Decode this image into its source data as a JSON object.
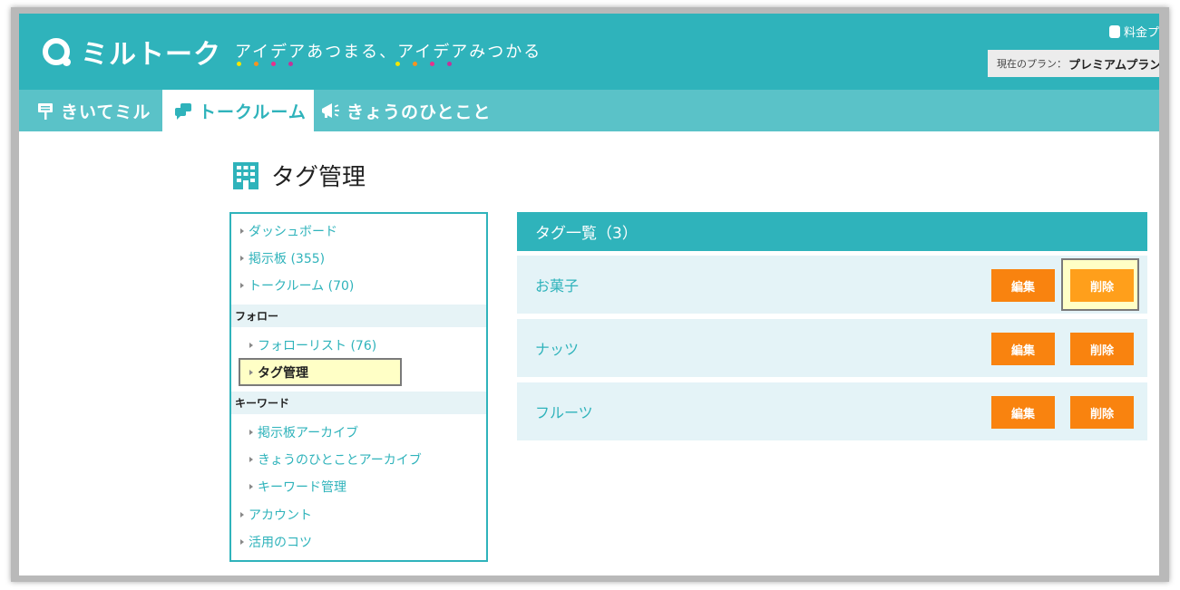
{
  "header": {
    "logo_text": "ミルトーク",
    "tagline": "アイデアあつまる、アイデアみつかる",
    "pricing_label": "料金プ",
    "plan_label": "現在のプラン：",
    "plan_value": "プレミアムプラン",
    "dot_colors": [
      "#f3e600",
      "#f7931e",
      "#e8308c",
      "#c2349a"
    ]
  },
  "nav": {
    "tabs": [
      {
        "label": "きいてミル",
        "active": false
      },
      {
        "label": "トークルーム",
        "active": true
      },
      {
        "label": "きょうのひとこと",
        "active": false
      }
    ]
  },
  "page": {
    "title": "タグ管理"
  },
  "sidebar": {
    "items": [
      {
        "label": "ダッシュボード"
      },
      {
        "label": "掲示板 (355)"
      },
      {
        "label": "トークルーム (70)"
      }
    ],
    "section_follow": "フォロー",
    "follow_items": [
      {
        "label": "フォローリスト (76)"
      },
      {
        "label": "タグ管理"
      }
    ],
    "section_keyword": "キーワード",
    "keyword_items": [
      {
        "label": "掲示板アーカイブ"
      },
      {
        "label": "きょうのひとことアーカイブ"
      },
      {
        "label": "キーワード管理"
      }
    ],
    "bottom_items": [
      {
        "label": "アカウント"
      },
      {
        "label": "活用のコツ"
      }
    ]
  },
  "tags": {
    "header": "タグ一覧（3）",
    "edit_label": "編集",
    "delete_label": "削除",
    "rows": [
      {
        "name": "お菓子"
      },
      {
        "name": "ナッツ"
      },
      {
        "name": "フルーツ"
      }
    ]
  },
  "colors": {
    "brand": "#2fb3bb",
    "nav": "#5ac2c8",
    "button": "#f9830f",
    "highlight": "#ffffc6"
  }
}
